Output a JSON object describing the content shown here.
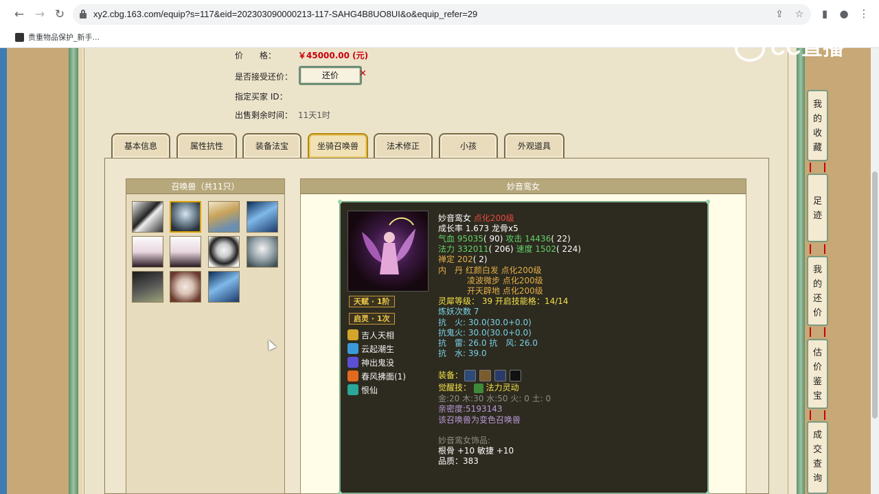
{
  "browser": {
    "url": "xy2.cbg.163.com/equip?s=117&eid=202303090000213-117-SAHG4B8UO8UI&o&equip_refer=29",
    "bookmark": "贵重物品保护_新手..."
  },
  "sale": {
    "price_label": "价　　格：",
    "price_value": "￥45000.00 (元)",
    "haggle_label": "是否接受还价：",
    "haggle_button": "还价",
    "haggle_mark": "✕",
    "buyer_label": "指定买家 ID：",
    "time_label": "出售剩余时间：",
    "time_value": "11天1时"
  },
  "tabs": [
    {
      "label": "基本信息"
    },
    {
      "label": "属性抗性"
    },
    {
      "label": "装备法宝"
    },
    {
      "label": "坐骑召唤兽"
    },
    {
      "label": "法术修正"
    },
    {
      "label": "小孩"
    },
    {
      "label": "外观道具"
    }
  ],
  "active_tab": 3,
  "pets_panel": {
    "title": "召唤兽（共11只）"
  },
  "detail_panel": {
    "title": "妙音鸾女"
  },
  "pet": {
    "name": "妙音鸾女",
    "level": "点化200级",
    "growth": "成长率 1.673 龙骨x5",
    "hp_label": "气血",
    "hp": "95035",
    "hp_pts": "( 90)",
    "atk_label": "攻击",
    "atk": "14436",
    "atk_pts": "( 22)",
    "mp_label": "法力",
    "mp": "332011",
    "mp_pts": "( 206)",
    "spd_label": "速度",
    "spd": "1502",
    "spd_pts": "( 224)",
    "zen_label": "禅定",
    "zen": "202",
    "zen_pts": "( 2)",
    "inner_label": "内　丹",
    "inner1": "红颜白发 点化200级",
    "inner2": "凌波微步 点化200级",
    "inner3": "开天辟地 点化200级",
    "spirit_label": "灵犀等级：",
    "spirit": "39 开启技能格：14/14",
    "demon": "炼妖次数 7",
    "resist_fire": "抗　火: 30.0(30.0+0.0)",
    "resist_ghost": "抗鬼火: 30.0(30.0+0.0)",
    "resist_thunder": "抗　雷: 26.0 抗　风: 26.0",
    "resist_water": "抗　水: 39.0",
    "equip_label": "装备：",
    "awaken_label": "觉醒技：",
    "awaken": "法力灵动",
    "elements": "金:20 木:30 水:50 火: 0 土: 0",
    "intimacy": "亲密度:5193143",
    "color_note": "该召唤兽为变色召唤兽",
    "ornament_title": "妙音鸾女饰品:",
    "ornament_stats": "根骨 +10 敏捷 +10",
    "ornament_quality": "品质：383",
    "badge_talent": "天赋 · 1阶",
    "badge_enlight": "启灵 · 1次",
    "skills": [
      {
        "name": "吉人天相",
        "icon": "lucky-icon",
        "color": "#d4a52a"
      },
      {
        "name": "云起潮生",
        "icon": "cloud-wave-icon",
        "color": "#3a9ad9"
      },
      {
        "name": "神出鬼没",
        "icon": "ghost-icon",
        "color": "#5b4fd6"
      },
      {
        "name": "春风拂面(1)",
        "icon": "fire-spring-icon",
        "color": "#e26a1f"
      },
      {
        "name": "恨仙",
        "icon": "immortal-icon",
        "color": "#2aa79a"
      }
    ]
  },
  "side_buttons": [
    {
      "label": [
        "我",
        "的",
        "收",
        "藏"
      ]
    },
    {
      "label": [
        "足",
        "迹"
      ]
    },
    {
      "label": [
        "我",
        "的",
        "还",
        "价"
      ]
    },
    {
      "label": [
        "估",
        "价",
        "鉴",
        "宝"
      ]
    },
    {
      "label": [
        "成",
        "交",
        "查",
        "询"
      ]
    }
  ],
  "watermark": "CC直播"
}
